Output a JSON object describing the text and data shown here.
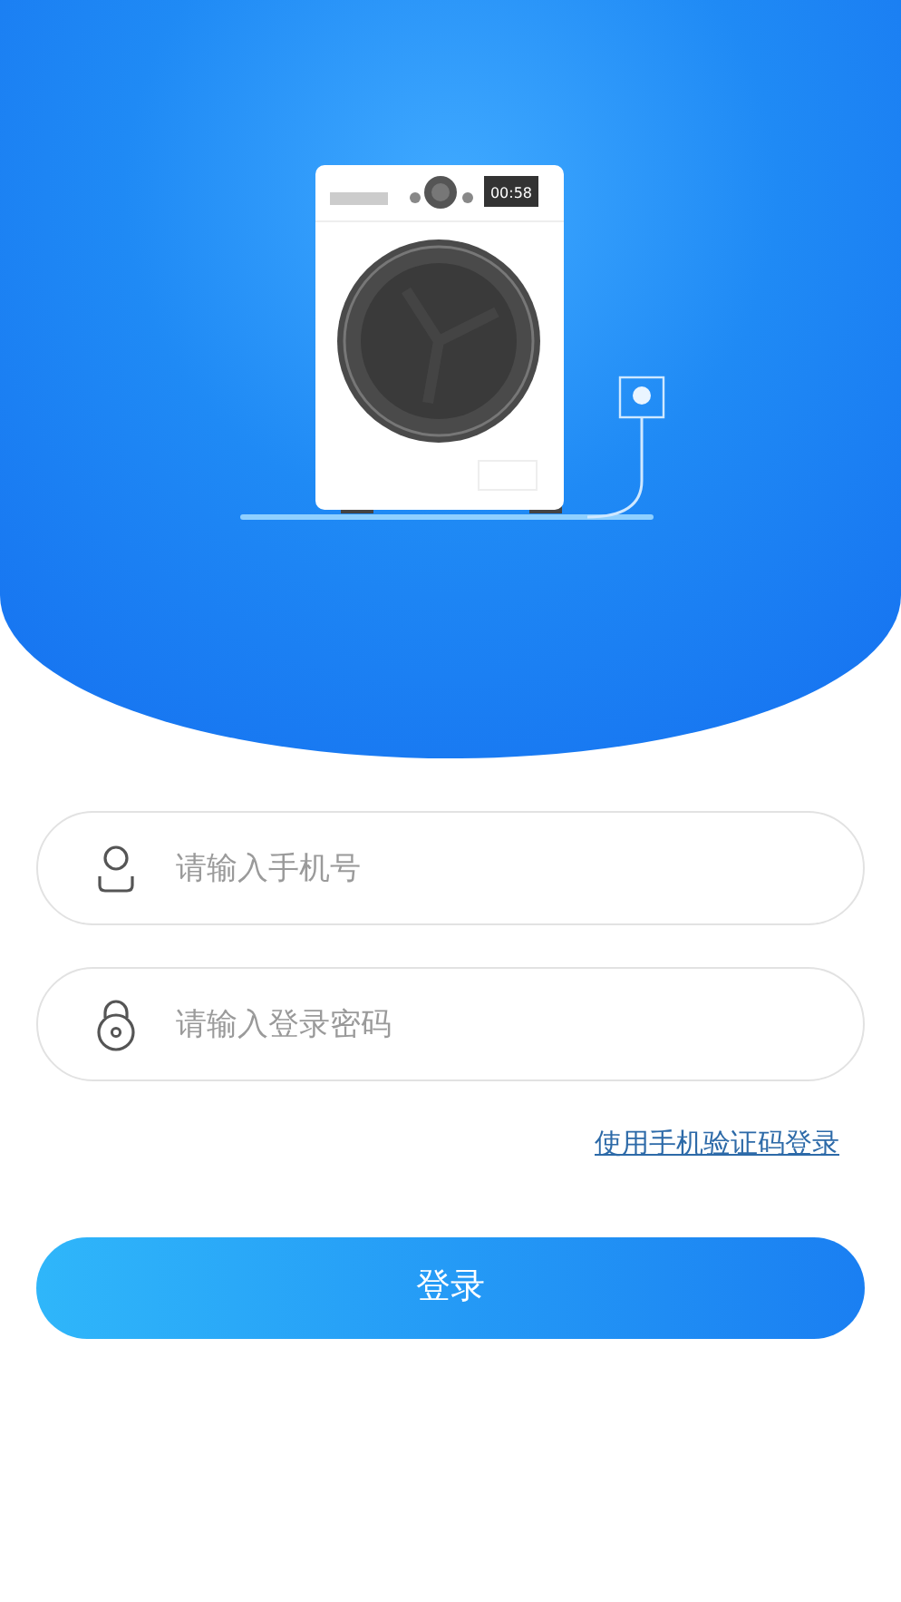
{
  "hero": {
    "display": "00:58"
  },
  "fields": [
    {
      "kind": "phone",
      "placeholder": "请输入手机号"
    },
    {
      "kind": "password",
      "placeholder": "请输入登录密码"
    }
  ],
  "sms_login_link": "使用手机验证码登录",
  "login_button": "登录"
}
